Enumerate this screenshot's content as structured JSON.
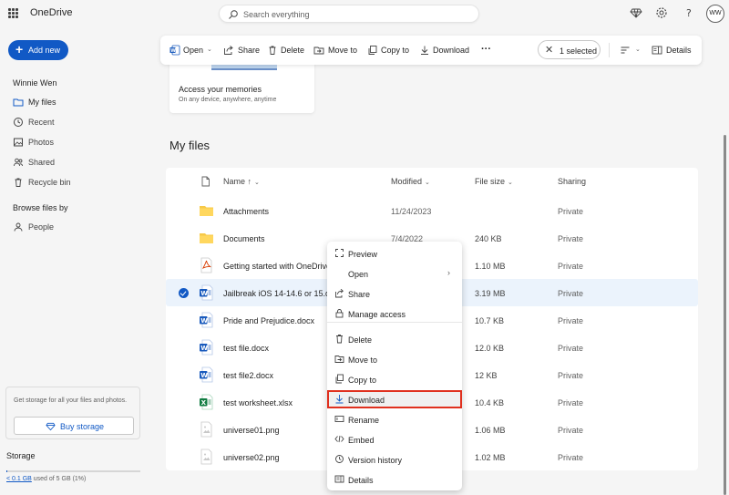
{
  "app": {
    "title": "OneDrive"
  },
  "search": {
    "placeholder": "Search everything"
  },
  "user": {
    "initials": "WW",
    "name": "Winnie Wen"
  },
  "sidebar": {
    "add_new": "Add new",
    "items": [
      {
        "label": "My files",
        "icon": "folder-icon"
      },
      {
        "label": "Recent",
        "icon": "clock-icon"
      },
      {
        "label": "Photos",
        "icon": "image-icon"
      },
      {
        "label": "Shared",
        "icon": "people-icon"
      },
      {
        "label": "Recycle bin",
        "icon": "trash-icon"
      }
    ],
    "browse_section": "Browse files by",
    "browse_items": [
      {
        "label": "People",
        "icon": "person-icon"
      }
    ],
    "storage_promo": "Get storage for all your files and photos.",
    "buy_storage": "Buy storage",
    "storage_title": "Storage",
    "storage_used_link": "< 0.1 GB",
    "storage_used_rest": " used of 5 GB (1%)",
    "storage_fraction": 0.01
  },
  "toolbar": {
    "open": "Open",
    "share": "Share",
    "delete": "Delete",
    "move_to": "Move to",
    "copy_to": "Copy to",
    "download": "Download",
    "more": "···",
    "selected": "1 selected",
    "details": "Details"
  },
  "promo": {
    "title": "Access your memories",
    "subtitle": "On any device, anywhere, anytime"
  },
  "section_title": "My files",
  "columns": {
    "name": "Name ↑",
    "modified": "Modified",
    "size": "File size",
    "sharing": "Sharing"
  },
  "files": [
    {
      "name": "Attachments",
      "type": "folder",
      "modified": "11/24/2023",
      "size": "",
      "sharing": "Private"
    },
    {
      "name": "Documents",
      "type": "folder",
      "modified": "7/4/2022",
      "size": "240 KB",
      "sharing": "Private"
    },
    {
      "name": "Getting started with OneDrive.",
      "type": "pdf",
      "modified": "",
      "size": "1.10 MB",
      "sharing": "Private"
    },
    {
      "name": "Jailbreak iOS 14-14.6 or 15.doc",
      "type": "word",
      "modified": "",
      "size": "3.19 MB",
      "sharing": "Private"
    },
    {
      "name": "Pride and Prejudice.docx",
      "type": "word",
      "modified": "",
      "size": "10.7 KB",
      "sharing": "Private"
    },
    {
      "name": "test file.docx",
      "type": "word",
      "modified": "",
      "size": "12.0 KB",
      "sharing": "Private"
    },
    {
      "name": "test file2.docx",
      "type": "word",
      "modified": "",
      "size": "12 KB",
      "sharing": "Private"
    },
    {
      "name": "test worksheet.xlsx",
      "type": "excel",
      "modified": "",
      "size": "10.4 KB",
      "sharing": "Private"
    },
    {
      "name": "universe01.png",
      "type": "image",
      "modified": "",
      "size": "1.06 MB",
      "sharing": "Private"
    },
    {
      "name": "universe02.png",
      "type": "image",
      "modified": "",
      "size": "1.02 MB",
      "sharing": "Private"
    }
  ],
  "context_menu": [
    {
      "label": "Preview",
      "icon": "preview-icon"
    },
    {
      "label": "Open",
      "icon": "",
      "submenu": true
    },
    {
      "label": "Share",
      "icon": "share-icon"
    },
    {
      "label": "Manage access",
      "icon": "lock-icon"
    },
    {
      "label": "Delete",
      "icon": "trash-icon"
    },
    {
      "label": "Move to",
      "icon": "move-icon"
    },
    {
      "label": "Copy to",
      "icon": "copy-icon"
    },
    {
      "label": "Download",
      "icon": "download-icon",
      "highlighted": true
    },
    {
      "label": "Rename",
      "icon": "rename-icon"
    },
    {
      "label": "Embed",
      "icon": "embed-icon"
    },
    {
      "label": "Version history",
      "icon": "history-icon"
    },
    {
      "label": "Details",
      "icon": "details-icon"
    }
  ],
  "colors": {
    "accent": "#1159c5",
    "highlight_border": "#e0301e",
    "selected_row": "#ebf3fc",
    "folder": "#f7c948",
    "word": "#185abd",
    "excel": "#107c41",
    "pdf": "#d83b01"
  }
}
